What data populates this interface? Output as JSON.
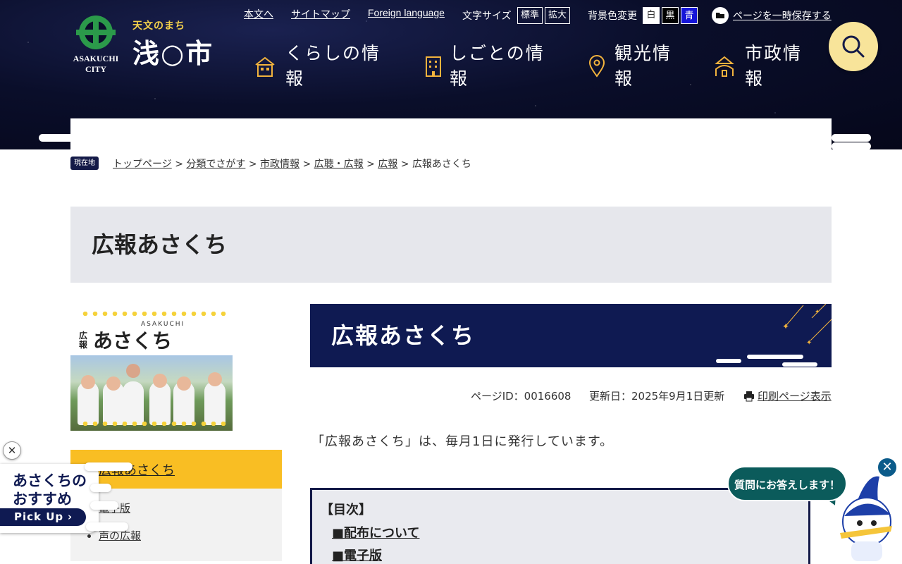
{
  "header": {
    "logo_sub": "天文のまち",
    "logo_name": "浅○市",
    "logo_en_1": "ASAKUCHI",
    "logo_en_2": "CITY",
    "links": {
      "main": "本文へ",
      "sitemap": "サイトマップ",
      "foreign": "Foreign language"
    },
    "font_size_label": "文字サイズ",
    "font_standard": "標準",
    "font_large": "拡大",
    "bgcolor_label": "背景色変更",
    "bg_white": "白",
    "bg_black": "黒",
    "bg_blue": "青",
    "save_label": "ページを一時保存する",
    "nav": [
      {
        "line1": "くらしの情",
        "line2": "報",
        "icon": "house-icon"
      },
      {
        "line1": "しごとの情",
        "line2": "報",
        "icon": "building-icon"
      },
      {
        "line1": "観光情",
        "line2": "報",
        "icon": "map-pin-icon"
      },
      {
        "line1": "市政情",
        "line2": "報",
        "icon": "city-hall-icon"
      }
    ],
    "search_icon": "search-icon"
  },
  "breadcrumb": {
    "here_label": "現在地",
    "items": [
      "トップページ",
      "分類でさがす",
      "市政情報",
      "広聴・広報",
      "広報"
    ],
    "current": "広報あさくち",
    "separator": ">"
  },
  "page_title": "広報あさくち",
  "sidebar": {
    "banner": {
      "small_text": "ASAKUCHI",
      "prefix": "広報",
      "title": "あさくち"
    },
    "nav_title": "広報あさくち",
    "items": [
      "電子版",
      "声の広報"
    ]
  },
  "main": {
    "hero_title": "広報あさくち",
    "page_id": "ページID：0016608",
    "updated": "更新日：2025年9月1日更新",
    "print": "印刷ページ表示",
    "intro": "「広報あさくち」は、毎月1日に発行しています。",
    "toc_title": "【目次】",
    "toc_items": [
      "■配布について",
      "■電子版"
    ]
  },
  "floating": {
    "pickup_line1": "あさくちの",
    "pickup_line2": "おすすめ",
    "pickup_btn": "Pick Up",
    "close_symbol": "✕",
    "chat_text": "質問にお答えします！"
  },
  "colors": {
    "navy": "#0f1a52",
    "accent_yellow": "#f9be23",
    "search_yellow": "#f8e49a",
    "chat_teal": "#0b5b5b"
  }
}
